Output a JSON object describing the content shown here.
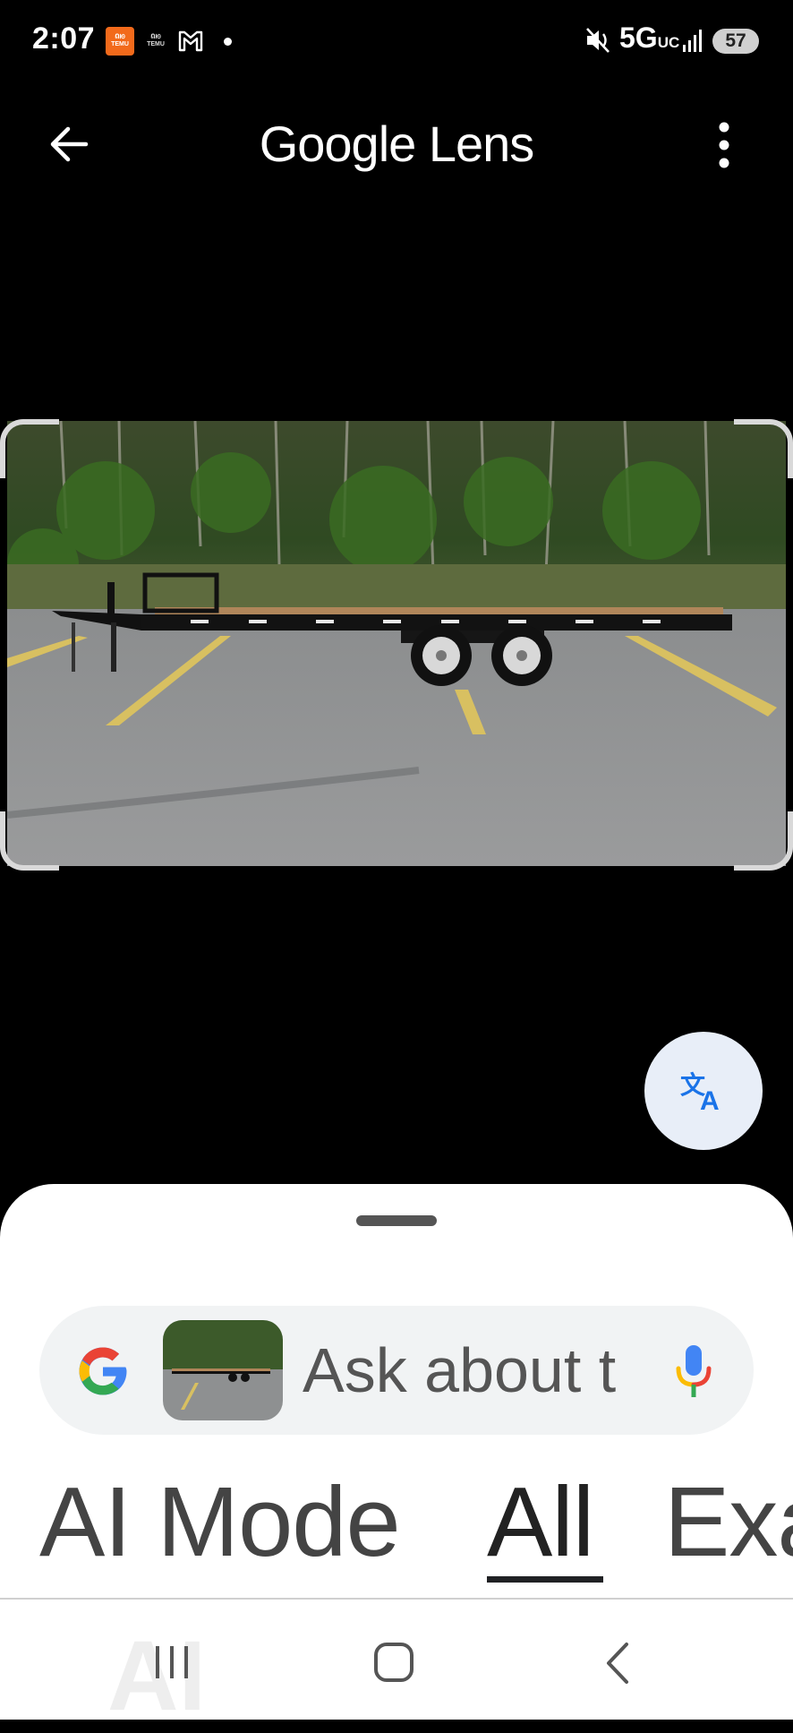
{
  "status_bar": {
    "time": "2:07",
    "temu_label": "TEMU",
    "network": "5G",
    "network_suffix": "UC",
    "battery": "57"
  },
  "header": {
    "title": "Google Lens"
  },
  "search": {
    "placeholder": "Ask about t"
  },
  "tabs": [
    {
      "label": "AI Mode"
    },
    {
      "label": "All"
    },
    {
      "label": "Exa"
    }
  ],
  "active_tab": "All",
  "nav_ghost_text": "AI",
  "colors": {
    "accent_blue": "#1a73e8",
    "sheet_bg": "#ffffff",
    "search_bg": "#f1f3f4",
    "temu_orange": "#f26a1b"
  }
}
